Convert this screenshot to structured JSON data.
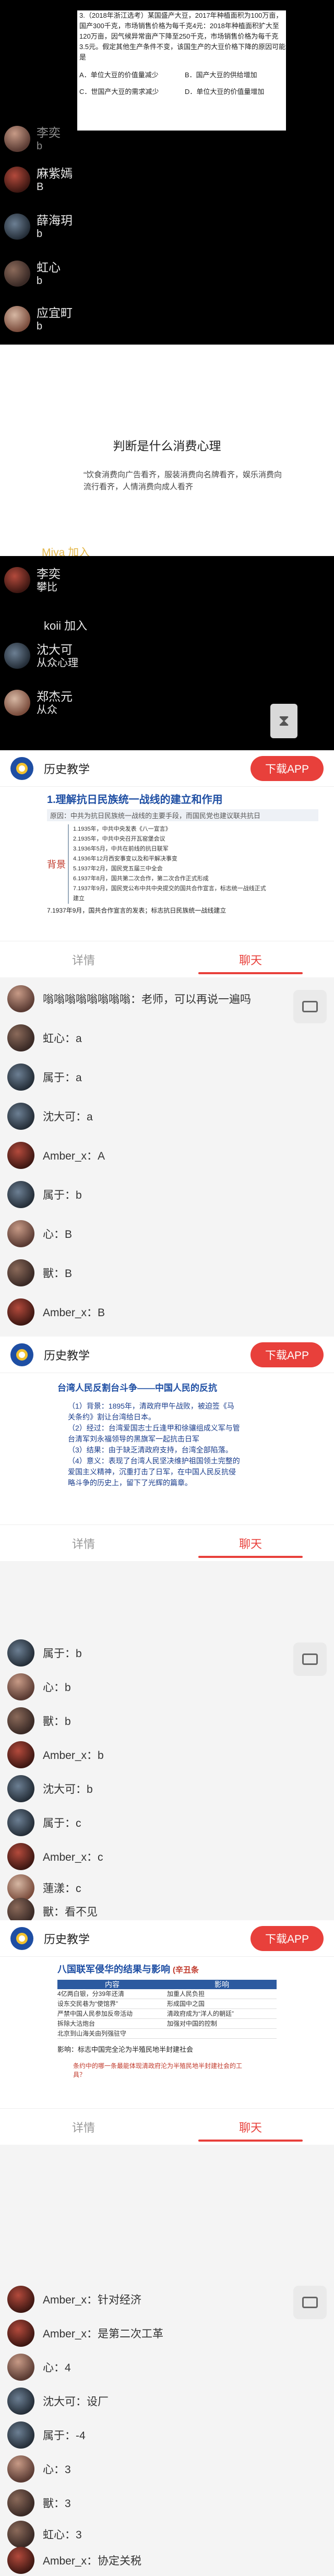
{
  "quiz": {
    "question": "3.（2018年浙江选考）某国盛产大豆，2017年种植面积为100万亩，国产300千克，市场销售价格为每千克4元：2018年种植面积扩大至120万亩，因气候异常亩产下降至250千克，市场销售价格为每千克3.5元。假定其他生产条件不变，该国生产的大豆价格下降的原因可能是",
    "options": [
      "A．单位大豆的价值量减少",
      "B．国产大豆的供给增加",
      "C．世国产大豆的需求减少",
      "D．单位大豆的价值量增加"
    ]
  },
  "chat_dark_1": [
    {
      "name": "李奕",
      "msg": "b"
    },
    {
      "name": "麻紫嫣",
      "msg": "B"
    },
    {
      "name": "薛海玥",
      "msg": "b"
    },
    {
      "name": "虹心",
      "msg": "b"
    },
    {
      "name": "应宜町",
      "msg": "b"
    }
  ],
  "board": {
    "title": "判断是什么消费心理",
    "body": "“饮食消费向广告看齐，服装消费向名牌看齐，娱乐消费向流行看齐，人情消费向成人看齐",
    "join": "Miya 加入"
  },
  "chat_dark_2": [
    {
      "name": "李奕",
      "msg": "攀比"
    },
    {
      "name": "koii 加入",
      "msg": ""
    },
    {
      "name": "沈大可",
      "msg": "从众心理"
    },
    {
      "name": "郑杰元",
      "msg": "从众"
    }
  ],
  "course": {
    "title": "历史教学",
    "download": "下载APP"
  },
  "tabs": {
    "details": "详情",
    "chat": "聊天"
  },
  "slide1": {
    "title": "1.理解抗日民族统一战线的建立和作用",
    "subtitle": "原因：中共为抗日民族统一战线的主要手段，而国民党也建议联共抗日",
    "side": "背景",
    "items": [
      "1.1935年，中共中央发表《八一宣言》",
      "2.1935年，中共中央召开瓦窑堡会议",
      "3.1936年5月，中共在前线的抗日联军",
      "4.1936年12月西安事变以及和平解决事变",
      "5.1937年2月，国民党五届三中全会",
      "6.1937年8月，国共第二次合作，第二次合作正式形成",
      "7.1937年9月，国民党公布中共中央提交的国共合作宣言，标志统一战线正式建立"
    ],
    "note": "7.1937年9月，国共合作宣言的发表；标志抗日民族统一战线建立"
  },
  "chat_light_1": [
    {
      "name": "嗡嗡嗡嗡嗡嗡嗡嗡",
      "msg": "老师，可以再说一遍吗"
    },
    {
      "name": "虹心",
      "msg": "a"
    },
    {
      "name": "属于",
      "msg": "a"
    },
    {
      "name": "沈大可",
      "msg": "a"
    },
    {
      "name": "Amber_x",
      "msg": "A"
    },
    {
      "name": "属于",
      "msg": "b"
    },
    {
      "name": "心",
      "msg": "B"
    },
    {
      "name": "獸",
      "msg": "B"
    },
    {
      "name": "Amber_x",
      "msg": "B"
    }
  ],
  "slide2": {
    "title": "台湾人民反割台斗争——中国人民的反抗",
    "lines": [
      "（1）背景：1895年，清政府甲午战败，被迫签《马关条约》割让台湾给日本。",
      "（2）经过：台湾爱国志士丘逢甲和徐骧组成义军与管台清军刘永福领导的黑旗军一起抗击日军",
      "（3）结果：由于缺乏清政府支持，台湾全部陷落。",
      "（4）意义：表现了台湾人民坚决维护祖国领土完整的爱国主义精神，沉重打击了日军，在中国人民反抗侵略斗争的历史上，留下了光辉的篇章。"
    ]
  },
  "chat_light_2": [
    {
      "name": "属于",
      "msg": "b"
    },
    {
      "name": "心",
      "msg": "b"
    },
    {
      "name": "獸",
      "msg": "b"
    },
    {
      "name": "Amber_x",
      "msg": "b"
    },
    {
      "name": "沈大可",
      "msg": "b"
    },
    {
      "name": "属于",
      "msg": "c"
    },
    {
      "name": "Amber_x",
      "msg": "c"
    },
    {
      "name": "蓮漾",
      "msg": "c"
    },
    {
      "name": "獸",
      "msg": "看不见"
    }
  ],
  "slide3": {
    "title": "八国联军侵华的结果与影响",
    "tag": "(辛丑条",
    "col1": "内容",
    "col2": "影响",
    "rows": [
      [
        "4亿两白银，分39年还清",
        "加重人民负担"
      ],
      [
        "设东交民巷为“使馆界”",
        "形成国中之国"
      ],
      [
        "严禁中国人民参加反帝活动",
        "清政府成为“洋人的朝廷”"
      ],
      [
        "拆除大沽炮台",
        "加强对中国的控制"
      ],
      [
        "北京到山海关由列强驻守",
        ""
      ]
    ],
    "conclusion": "影响：标志中国完全沦为半殖民地半封建社会",
    "question": "条约中的哪一条最能体现清政府沦为半殖民地半封建社会的工具？"
  },
  "chat_light_3": [
    {
      "name": "Amber_x",
      "msg": "针对经济"
    },
    {
      "name": "Amber_x",
      "msg": "是第二次工革"
    },
    {
      "name": "心",
      "msg": "4"
    },
    {
      "name": "沈大可",
      "msg": "设厂"
    },
    {
      "name": "属于",
      "msg": "-4"
    },
    {
      "name": "心",
      "msg": "3"
    },
    {
      "name": "獸",
      "msg": "3"
    },
    {
      "name": "虹心",
      "msg": "3"
    },
    {
      "name": "Amber_x",
      "msg": "协定关税"
    }
  ]
}
